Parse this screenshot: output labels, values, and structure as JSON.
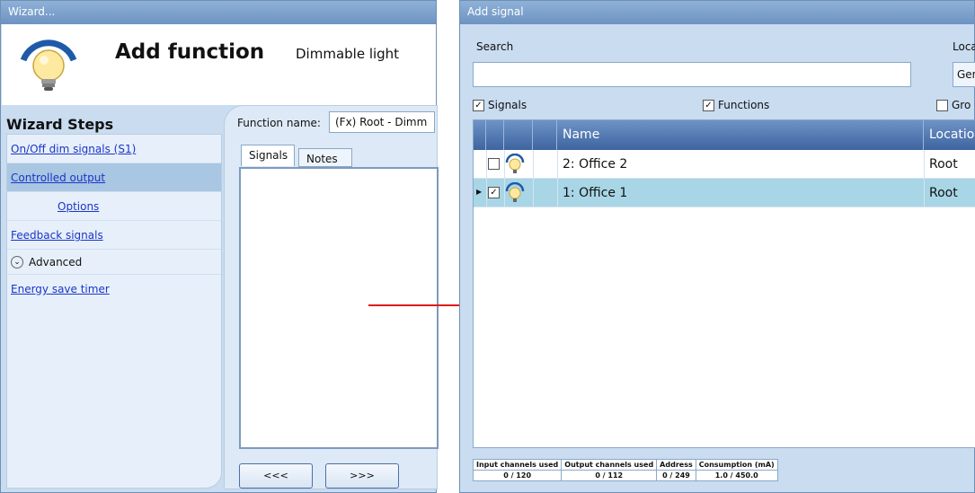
{
  "wizard": {
    "window_title": "Wizard...",
    "title": "Add function",
    "subtitle": "Dimmable light",
    "steps_title": "Wizard Steps",
    "steps": [
      "On/Off dim signals (S1)",
      "Controlled output",
      "Options",
      "Feedback signals"
    ],
    "advanced_label": "Advanced",
    "energy_step": "Energy save timer",
    "function_name_label": "Function name:",
    "function_name_value": "(Fx) Root - Dimm",
    "tabs": [
      "Signals",
      "Notes"
    ],
    "prev_button": "<<<",
    "next_button": ">>>"
  },
  "add_signal": {
    "window_title": "Add signal",
    "search_label": "Search",
    "location_label": "Loca",
    "location_value": "Ger",
    "filters": {
      "signals": "Signals",
      "functions": "Functions",
      "groups": "Gro"
    },
    "columns": [
      "Name",
      "Location"
    ],
    "rows": [
      {
        "name": "2: Office 2",
        "location": "Root",
        "checked": false,
        "selected": false
      },
      {
        "name": "1: Office 1",
        "location": "Root",
        "checked": true,
        "selected": true
      }
    ],
    "status": {
      "headers": [
        "Input channels used",
        "Output channels used",
        "Address",
        "Consumption (mA)"
      ],
      "values": [
        "0 / 120",
        "0 / 112",
        "0 / 249",
        "1.0 / 450.0"
      ]
    }
  },
  "colors": {
    "accent": "#3e64a0",
    "selected_row": "#a8d6e6",
    "arrow": "#e01b1b"
  }
}
